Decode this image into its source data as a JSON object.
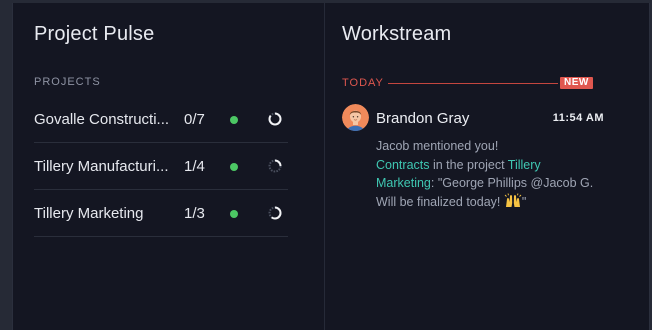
{
  "project_pulse": {
    "title": "Project Pulse",
    "section_label": "PROJECTS",
    "projects": [
      {
        "name": "Govalle Constructi...",
        "count": "0/7",
        "status_color": "#4cc764",
        "progress": 0.85
      },
      {
        "name": "Tillery Manufacturi...",
        "count": "1/4",
        "status_color": "#4cc764",
        "progress": 0.25
      },
      {
        "name": "Tillery Marketing",
        "count": "1/3",
        "status_color": "#4cc764",
        "progress": 0.6
      }
    ]
  },
  "workstream": {
    "title": "Workstream",
    "today_label": "TODAY",
    "new_badge": "NEW",
    "entry": {
      "author": "Brandon Gray",
      "time": "11:54 AM",
      "headline": "Jacob mentioned you!",
      "link1": "Contracts",
      "text_in_project": " in the project ",
      "link2": "Tillery Marketing",
      "quote": ": \"George Phillips @Jacob G. Will be finalized today! ",
      "quote_end": "\"",
      "emoji_icon": "raised-hands-emoji"
    }
  },
  "colors": {
    "accent_link": "#3fc7b2",
    "today_red": "#e0574f",
    "status_green": "#4cc764"
  }
}
